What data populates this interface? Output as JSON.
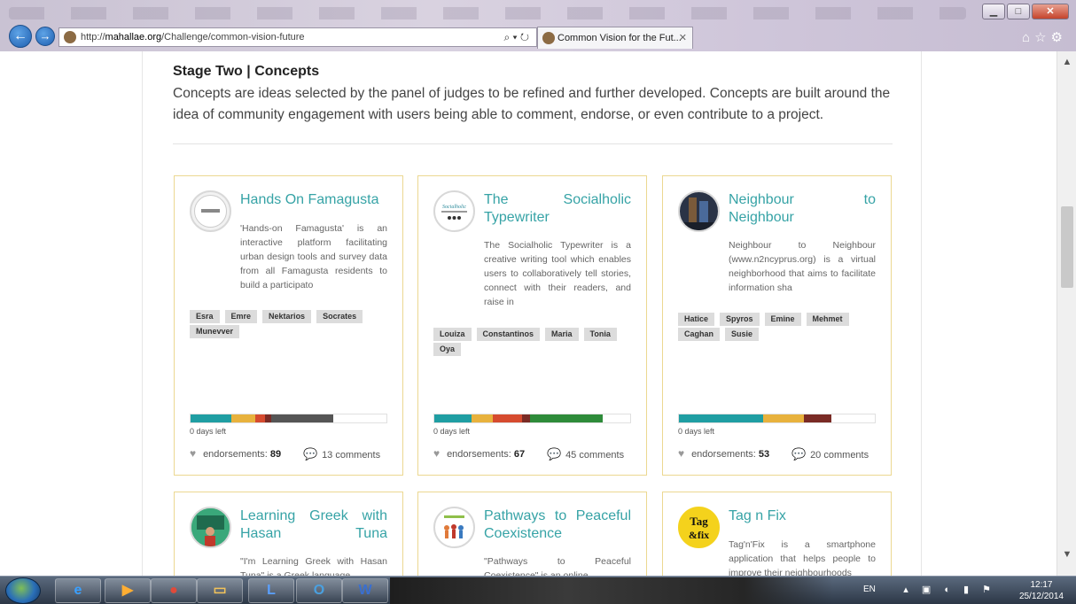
{
  "browser": {
    "url_prefix": "http://",
    "url_host": "mahallae.org",
    "url_path": "/Challenge/common-vision-future",
    "addr_controls": "⌕ ▾ ↻",
    "tab_title": "Common Vision for the Fut...",
    "tab_close": "✕",
    "back_glyph": "←",
    "forward_glyph": "→",
    "tool_icons": "⌂☆⚙",
    "win_min": "▁",
    "win_max": "□",
    "win_close": "✕"
  },
  "stage": {
    "title": "Stage Two | Concepts",
    "description": "Concepts are ideas selected by the panel of judges to be refined and further developed. Concepts are built around the idea of community engagement with users being able to comment, endorse, or even contribute to a project."
  },
  "labels": {
    "endorsements": "endorsements:",
    "comments": "comments"
  },
  "cards": [
    {
      "title": "Hands On Famagusta",
      "description": "'Hands-on Famagusta' is an interactive platform facilitating urban design tools and survey data from all Famagusta residents to build a participato",
      "tags": [
        "Esra",
        "Emre",
        "Nektarios",
        "Socrates",
        "Munevver"
      ],
      "progress": [
        {
          "color": "#1f9ea3",
          "fraction": 0.21
        },
        {
          "color": "#e8b23d",
          "fraction": 0.12
        },
        {
          "color": "#d64b2f",
          "fraction": 0.05
        },
        {
          "color": "#7a2b25",
          "fraction": 0.03
        },
        {
          "color": "#555555",
          "fraction": 0.32
        }
      ],
      "days_left": "0 days left",
      "endorsements": "89",
      "comments": "13"
    },
    {
      "title": "The Socialholic Typewriter",
      "description": "The Socialholic Typewriter is a creative writing tool which enables users to collaboratively tell stories, connect with their readers, and raise in",
      "tags": [
        "Louiza",
        "Constantinos",
        "Maria",
        "Tonia",
        "Oya"
      ],
      "progress": [
        {
          "color": "#1f9ea3",
          "fraction": 0.19
        },
        {
          "color": "#e8b23d",
          "fraction": 0.11
        },
        {
          "color": "#d64b2f",
          "fraction": 0.15
        },
        {
          "color": "#7a2b25",
          "fraction": 0.04
        },
        {
          "color": "#2e8b3a",
          "fraction": 0.37
        }
      ],
      "days_left": "0 days left",
      "endorsements": "67",
      "comments": "45"
    },
    {
      "title": "Neighbour to Neighbour",
      "description": "Neighbour to Neighbour (www.n2ncyprus.org) is a virtual neighborhood that aims to facilitate information sha",
      "tags": [
        "Hatice",
        "Spyros",
        "Emine",
        "Mehmet",
        "Caghan",
        "Susie"
      ],
      "progress": [
        {
          "color": "#1f9ea3",
          "fraction": 0.43
        },
        {
          "color": "#e8b23d",
          "fraction": 0.21
        },
        {
          "color": "#7a2b25",
          "fraction": 0.14
        }
      ],
      "days_left": "0 days left",
      "endorsements": "53",
      "comments": "20"
    },
    {
      "title": "Learning Greek with Hasan Tuna",
      "description": "\"I'm Learning Greek with Hasan Tuna\" is a Greek language"
    },
    {
      "title": "Pathways to Peaceful Coexistence",
      "description": "\"Pathways to Peaceful Coexistence\" is an online"
    },
    {
      "title": "Tag n Fix",
      "description": "Tag'n'Fix is a smartphone application that helps people to improve their neighbourhoods"
    }
  ],
  "taskbar": {
    "lang": "EN",
    "time": "12:17",
    "date": "25/12/2014"
  }
}
